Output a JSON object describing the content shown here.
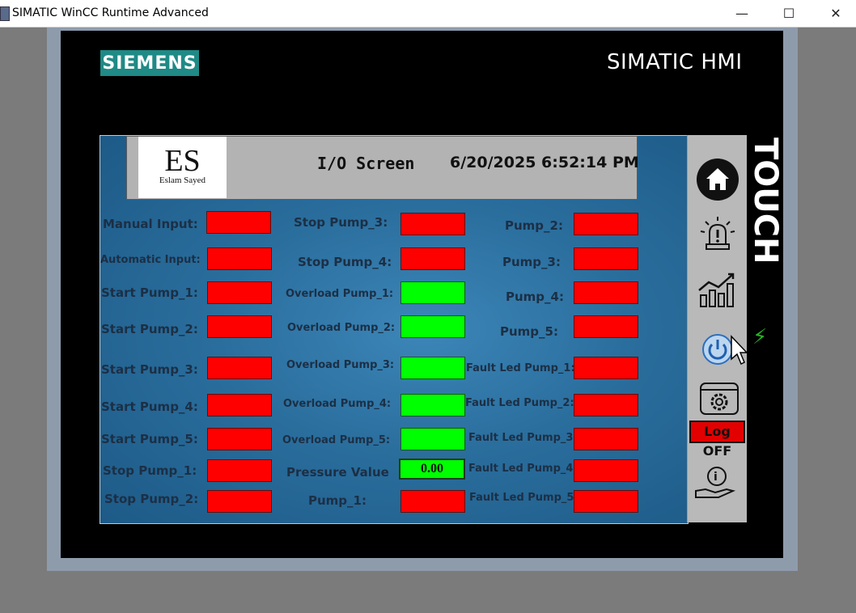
{
  "window": {
    "title": "SIMATIC WinCC Runtime Advanced",
    "minimize": "—",
    "maximize": "☐",
    "close": "✕"
  },
  "panel": {
    "brand": "SIEMENS",
    "product": "SIMATIC HMI",
    "touch": "TOUCH"
  },
  "header": {
    "logo_big": "ES",
    "logo_small": "Eslam Sayed",
    "screen_title": "I/O Screen",
    "datetime": "6/20/2025 6:52:14 PM"
  },
  "col1": [
    {
      "label": "Manual Input:",
      "state": "off"
    },
    {
      "label": "Automatic Input:",
      "state": "off"
    },
    {
      "label": "Start Pump_1:",
      "state": "off"
    },
    {
      "label": "Start Pump_2:",
      "state": "off"
    },
    {
      "label": "Start Pump_3:",
      "state": "off"
    },
    {
      "label": "Start Pump_4:",
      "state": "off"
    },
    {
      "label": "Start Pump_5:",
      "state": "off"
    },
    {
      "label": "Stop Pump_1:",
      "state": "off"
    },
    {
      "label": "Stop Pump_2:",
      "state": "off"
    }
  ],
  "col2": [
    {
      "label": "Stop Pump_3:",
      "state": "off"
    },
    {
      "label": "Stop Pump_4:",
      "state": "off"
    },
    {
      "label": "Overload Pump_1:",
      "state": "on"
    },
    {
      "label": "Overload Pump_2:",
      "state": "on"
    },
    {
      "label": "Overload Pump_3:",
      "state": "on"
    },
    {
      "label": "Overload Pump_4:",
      "state": "on"
    },
    {
      "label": "Overload Pump_5:",
      "state": "on"
    },
    {
      "label": "Pressure Value",
      "value": "0.00"
    },
    {
      "label": "Pump_1:",
      "state": "off"
    }
  ],
  "col3": [
    {
      "label": "Pump_2:",
      "state": "off"
    },
    {
      "label": "Pump_3:",
      "state": "off"
    },
    {
      "label": "Pump_4:",
      "state": "off"
    },
    {
      "label": "Pump_5:",
      "state": "off"
    },
    {
      "label": "Fault Led Pump_1:",
      "state": "off"
    },
    {
      "label": "Fault Led Pump_2:",
      "state": "off"
    },
    {
      "label": "Fault Led Pump_3:",
      "state": "off"
    },
    {
      "label": "Fault Led Pump_4:",
      "state": "off"
    },
    {
      "label": "Fault Led Pump_5:",
      "state": "off"
    }
  ],
  "side": {
    "logoff_label": "Log OFF"
  },
  "colors": {
    "on": "#00ff00",
    "off": "#ff0000",
    "siemens": "#1f8a86"
  }
}
